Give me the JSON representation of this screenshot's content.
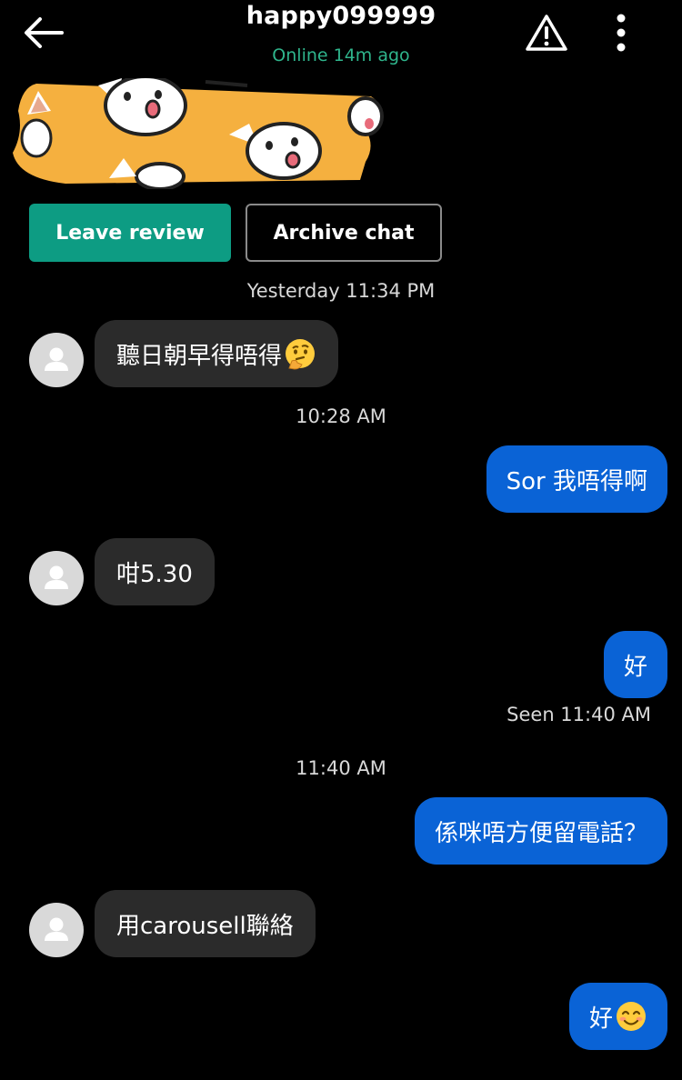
{
  "header": {
    "username": "happy099999",
    "status": "Online 14m ago"
  },
  "actions": {
    "leave_review": "Leave review",
    "archive_chat": "Archive chat"
  },
  "timestamps": {
    "t1": "Yesterday 11:34 PM",
    "t2": "10:28 AM",
    "t3": "11:40 AM"
  },
  "messages": [
    {
      "from": "them",
      "text": "聽日朝早得唔得",
      "emoji": "thinking-face-emoji"
    },
    {
      "from": "me",
      "text": "Sor 我唔得啊"
    },
    {
      "from": "them",
      "text": "咁5.30"
    },
    {
      "from": "me",
      "text": "好"
    },
    {
      "from": "me",
      "text": "係咪唔方便留電話？"
    },
    {
      "from": "them",
      "text": "用carousell聯絡"
    },
    {
      "from": "me",
      "text": "好",
      "emoji": "smiling-face-emoji"
    }
  ],
  "receipt": "Seen 11:40 AM",
  "colors": {
    "background": "#000000",
    "accent_green": "#0d9c83",
    "status_green": "#2fb58c",
    "outgoing_bubble": "#0a63d6",
    "incoming_bubble": "#2b2b2b"
  },
  "icons": {
    "back": "arrow-left-icon",
    "report": "warning-triangle-icon",
    "more": "more-vertical-icon",
    "avatar": "default-user-icon"
  }
}
